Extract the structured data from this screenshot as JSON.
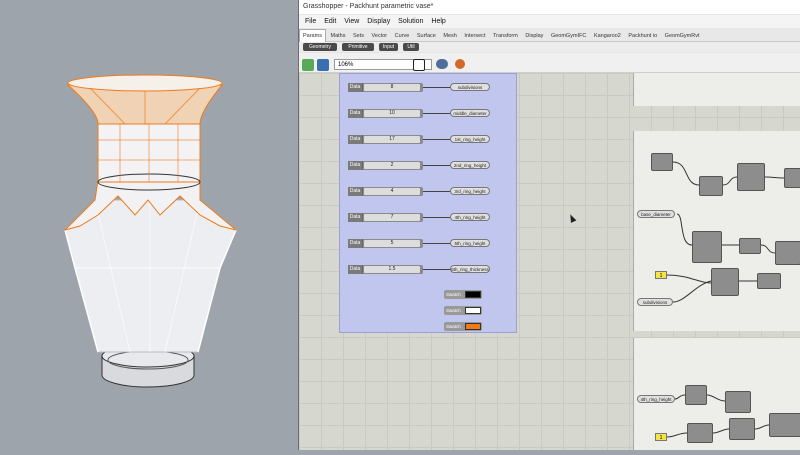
{
  "window": {
    "title": "Grasshopper - Packhunt parametric vase*"
  },
  "menu": [
    "File",
    "Edit",
    "View",
    "Display",
    "Solution",
    "Help"
  ],
  "tabs": [
    "Params",
    "Maths",
    "Sets",
    "Vector",
    "Curve",
    "Surface",
    "Mesh",
    "Intersect",
    "Transform",
    "Display",
    "GeomGymIFC",
    "Kangaroo2",
    "Packhunt io",
    "GeomGymRvt"
  ],
  "subtabs": [
    "Geometry",
    "Primitive",
    "Input",
    "Util"
  ],
  "toolbar": {
    "zoom": "106%"
  },
  "sliders": [
    {
      "tag": "Data",
      "value": "8",
      "param": "subdivisions"
    },
    {
      "tag": "Data",
      "value": "10",
      "param": "middle_diameter"
    },
    {
      "tag": "Data",
      "value": "17",
      "param": "1st_ring_height"
    },
    {
      "tag": "Data",
      "value": "2",
      "param": "2nd_ring_height"
    },
    {
      "tag": "Data",
      "value": "4",
      "param": "3rd_ring_height"
    },
    {
      "tag": "Data",
      "value": "7",
      "param": "4th_ring_height"
    },
    {
      "tag": "Data",
      "value": "5",
      "param": "5th_ring_height"
    },
    {
      "tag": "Data",
      "value": "1.5",
      "param": "5th_ring_thickness"
    }
  ],
  "swatches": [
    {
      "label": "Swatch",
      "color": "#000000"
    },
    {
      "label": "Swatch",
      "color": "#ffffff"
    },
    {
      "label": "Swatch",
      "color": "#f07a1a"
    }
  ],
  "canvas_params": {
    "base_diameter": "base_diameter",
    "subdivisions": "subdivisions",
    "ring": "4th_ring_height"
  },
  "yellow_value": "1",
  "colors": {
    "group": "#c1c6ef",
    "highlight": "#f07a1a"
  }
}
